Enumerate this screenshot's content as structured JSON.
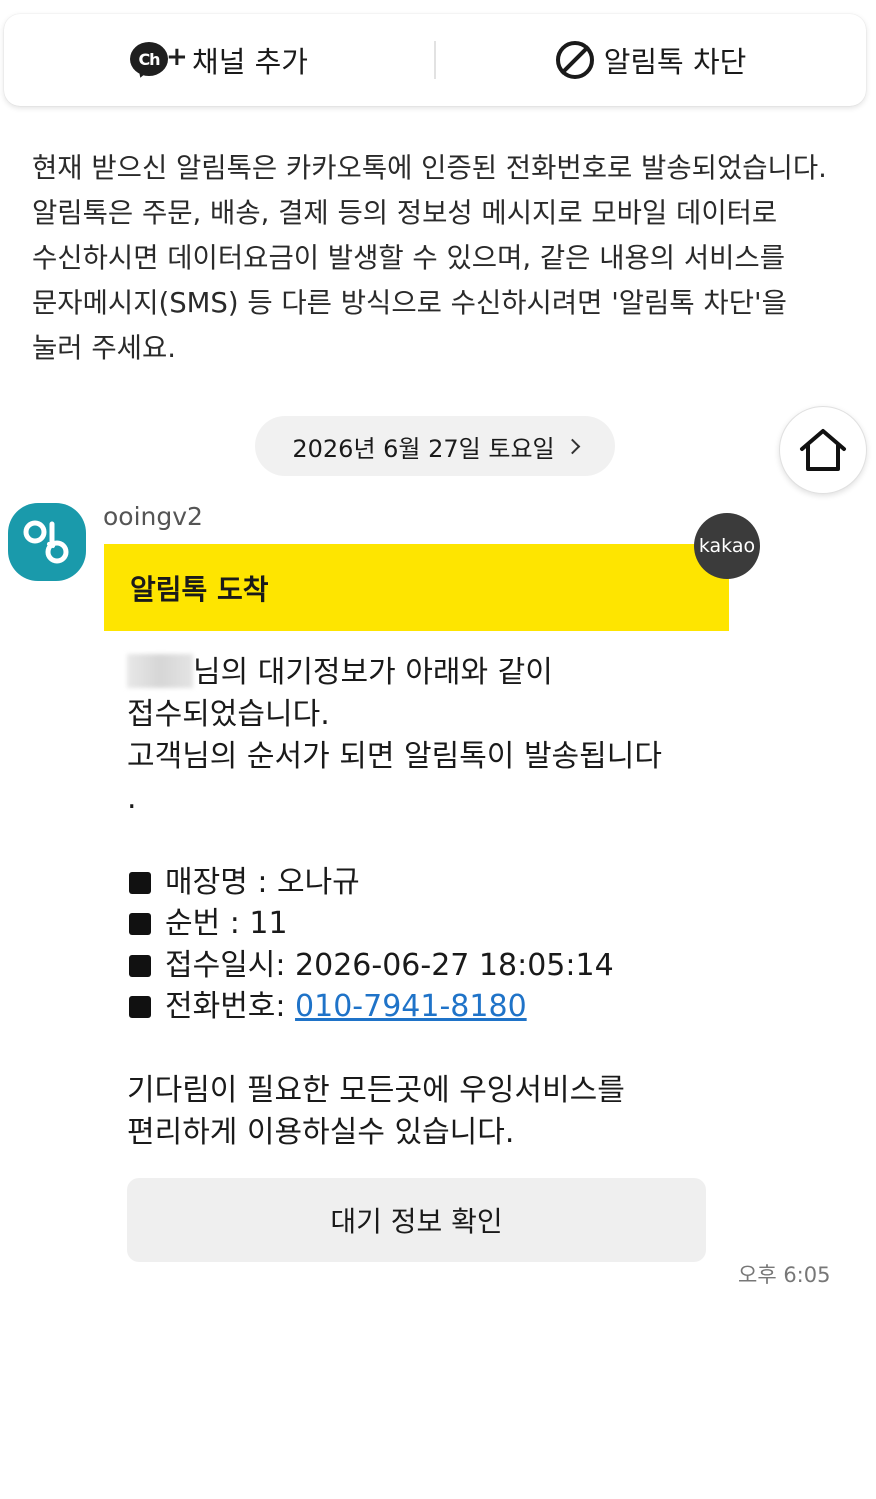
{
  "top_bar": {
    "add_channel_label": "채널 추가",
    "add_channel_icon_text": "Ch",
    "block_label": "알림톡 차단"
  },
  "notice": {
    "text": "현재 받으신 알림톡은 카카오톡에 인증된 전화번호로 발송되었습니다. 알림톡은 주문, 배송, 결제 등의 정보성 메시지로 모바일 데이터로 수신하시면 데이터요금이 발생할 수 있으며, 같은 내용의 서비스를 문자메시지(SMS) 등 다른 방식으로 수신하시려면 '알림톡 차단'을 눌러 주세요."
  },
  "date_pill": {
    "label": "2026년 6월 27일 토요일"
  },
  "sender": {
    "name": "ooingv2"
  },
  "message": {
    "badge": "kakao",
    "header": "알림톡 도착",
    "intro_suffix": "님의 대기정보가 아래와 같이 접수되었습니다.",
    "intro_line2": "고객님의 순서가 되면 알림톡이 발송됩니다\n.",
    "info": {
      "store": "매장명 : 오나규",
      "number": "순번 : 11",
      "received": "접수일시: 2026-06-27 18:05:14",
      "phone_label": "전화번호: ",
      "phone": "010-7941-8180"
    },
    "closing": "기다림이 필요한 모든곳에 우잉서비스를 편리하게 이용하실수 있습니다.",
    "button_label": "대기 정보 확인",
    "time": "오후 6:05"
  },
  "colors": {
    "kakao_yellow": "#fee500",
    "avatar_teal": "#1a9aab",
    "link_blue": "#1f73c8"
  },
  "icons": [
    "channel-add-icon",
    "block-icon",
    "chevron-right-icon",
    "home-icon",
    "avatar-logo-icon",
    "square-bullet-icon"
  ]
}
